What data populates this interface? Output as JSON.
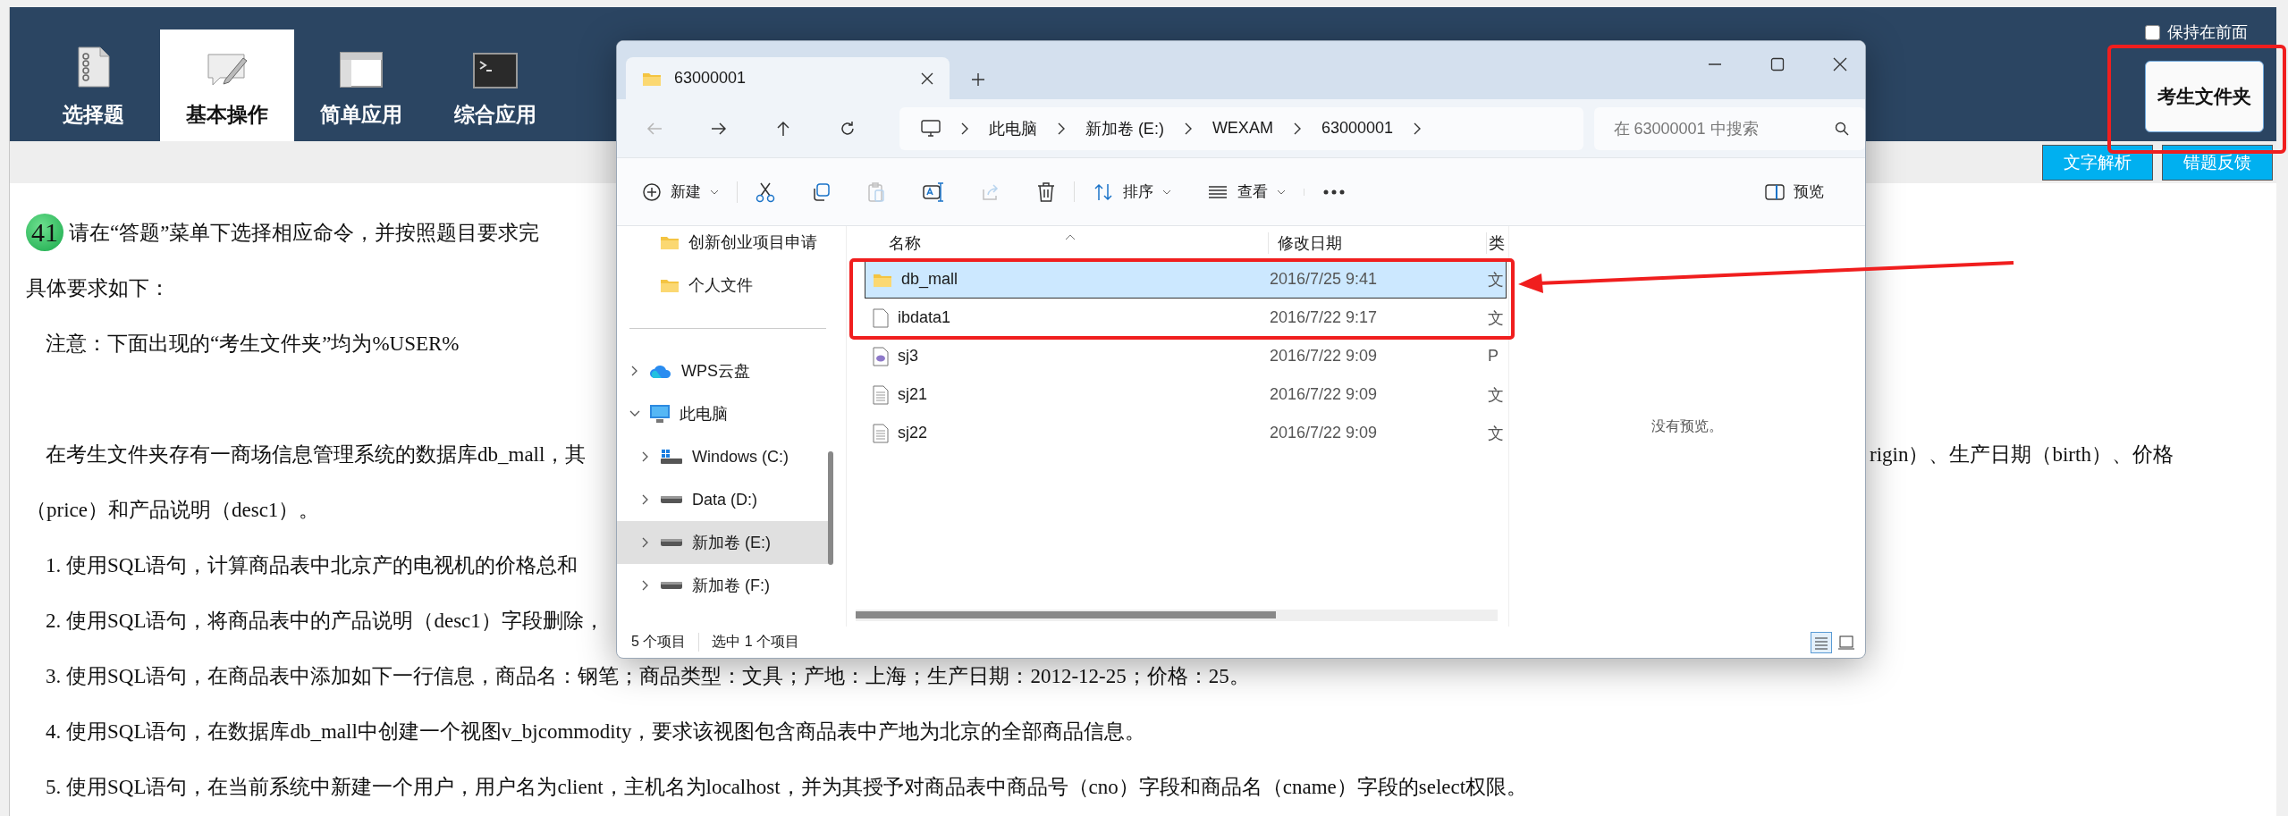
{
  "exam": {
    "tabs": [
      {
        "label": "选择题",
        "kind": "list",
        "selected": false
      },
      {
        "label": "基本操作",
        "kind": "edit",
        "selected": true
      },
      {
        "label": "简单应用",
        "kind": "window",
        "selected": false
      },
      {
        "label": "综合应用",
        "kind": "terminal",
        "selected": false
      }
    ],
    "keep_on_top": {
      "label": "保持在前面",
      "checked": false
    },
    "folder_button": "考生文件夹",
    "action_buttons": [
      "文字解析",
      "错题反馈"
    ],
    "question": {
      "number": "41",
      "lines": [
        {
          "kind": "question",
          "text": "请在“答题”菜单下选择相应命令，并按照题目要求完"
        },
        {
          "kind": "heading",
          "text": "具体要求如下："
        },
        {
          "kind": "note",
          "text": "注意：下面出现的“考生文件夹”均为%USER%"
        },
        {
          "kind": "paragraph",
          "text": "在考生文件夹存有一商场信息管理系统的数据库db_mall，其",
          "text_right": "rigin）、生产日期（birth）、价格"
        },
        {
          "kind": "continuation",
          "text": "（price）和产品说明（desc1）。"
        },
        {
          "kind": "item",
          "text": "1. 使用SQL语句，计算商品表中北京产的电视机的价格总和"
        },
        {
          "kind": "item",
          "text": "2. 使用SQL语句，将商品表中的产品说明（desc1）字段删除，"
        },
        {
          "kind": "item",
          "text": "3. 使用SQL语句，在商品表中添加如下一行信息，商品名：钢笔；商品类型：文具；产地：上海；生产日期：2012-12-25；价格：25。"
        },
        {
          "kind": "item",
          "text": "4. 使用SQL语句，在数据库db_mall中创建一个视图v_bjcommodity，要求该视图包含商品表中产地为北京的全部商品信息。"
        },
        {
          "kind": "item",
          "text": "5. 使用SQL语句，在当前系统中新建一个用户，用户名为client，主机名为localhost，并为其授予对商品表中商品号（cno）字段和商品名（cname）字段的select权限。"
        }
      ]
    }
  },
  "explorer": {
    "tab_title": "63000001",
    "nav_buttons": [
      {
        "kind": "back",
        "disabled": true
      },
      {
        "kind": "forward",
        "disabled": false
      },
      {
        "kind": "up",
        "disabled": false
      },
      {
        "kind": "refresh",
        "disabled": false
      }
    ],
    "breadcrumb": [
      "此电脑",
      "新加卷 (E:)",
      "WEXAM",
      "63000001"
    ],
    "search": {
      "placeholder": "在 63000001 中搜索"
    },
    "toolbar": [
      [
        {
          "kind": "new",
          "label": "新建",
          "disabled": false
        }
      ],
      [
        {
          "kind": "cut",
          "disabled": false
        },
        {
          "kind": "copy",
          "disabled": false
        },
        {
          "kind": "paste",
          "disabled": true
        },
        {
          "kind": "rename",
          "disabled": false
        },
        {
          "kind": "share",
          "disabled": true
        },
        {
          "kind": "delete",
          "disabled": false
        }
      ],
      [
        {
          "kind": "sort",
          "label": "排序",
          "disabled": false
        },
        {
          "kind": "view",
          "label": "查看",
          "disabled": false
        }
      ],
      [
        {
          "kind": "more",
          "disabled": false
        }
      ]
    ],
    "preview_button": "预览",
    "quick_access": [
      {
        "label": "创新创业项目申请",
        "kind": "folder",
        "selected": false
      },
      {
        "label": "个人文件",
        "kind": "folder",
        "selected": false
      }
    ],
    "tree": [
      {
        "label": "WPS云盘",
        "kind": "cloud",
        "expanded": false,
        "selected": false
      },
      {
        "label": "此电脑",
        "kind": "pc",
        "expanded": true,
        "selected": false,
        "children": [
          {
            "label": "Windows (C:)",
            "kind": "system-drive",
            "expanded": false,
            "selected": false
          },
          {
            "label": "Data (D:)",
            "kind": "drive",
            "expanded": false,
            "selected": false
          },
          {
            "label": "新加卷 (E:)",
            "kind": "drive",
            "expanded": false,
            "selected": true
          },
          {
            "label": "新加卷 (F:)",
            "kind": "drive",
            "expanded": false,
            "selected": false
          }
        ]
      }
    ],
    "columns": [
      "名称",
      "修改日期",
      "类"
    ],
    "files": [
      {
        "name": "db_mall",
        "modified": "2016/7/25 9:41",
        "type": "文",
        "kind": "folder",
        "selected": true
      },
      {
        "name": "ibdata1",
        "modified": "2016/7/22 9:17",
        "type": "文",
        "kind": "file",
        "selected": false
      },
      {
        "name": "sj3",
        "modified": "2016/7/22 9:09",
        "type": "P",
        "kind": "script",
        "selected": false
      },
      {
        "name": "sj21",
        "modified": "2016/7/22 9:09",
        "type": "文",
        "kind": "text",
        "selected": false
      },
      {
        "name": "sj22",
        "modified": "2016/7/22 9:09",
        "type": "文",
        "kind": "text",
        "selected": false
      }
    ],
    "preview_message": "没有预览。",
    "status": [
      "5 个项目",
      "选中 1 个项目"
    ]
  }
}
